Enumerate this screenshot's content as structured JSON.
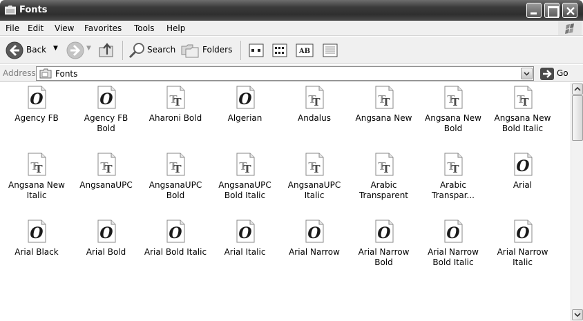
{
  "window": {
    "title": "Fonts"
  },
  "menu": [
    "File",
    "Edit",
    "View",
    "Favorites",
    "Tools",
    "Help"
  ],
  "toolbar": {
    "back_label": "Back",
    "search_label": "Search",
    "folders_label": "Folders"
  },
  "address": {
    "label": "Address",
    "value": "Fonts",
    "go_label": "Go"
  },
  "fonts": [
    {
      "name": "Agency FB",
      "type": "opentype"
    },
    {
      "name": "Agency FB\nBold",
      "type": "opentype"
    },
    {
      "name": "Aharoni Bold",
      "type": "truetype"
    },
    {
      "name": "Algerian",
      "type": "opentype"
    },
    {
      "name": "Andalus",
      "type": "truetype"
    },
    {
      "name": "Angsana New",
      "type": "truetype"
    },
    {
      "name": "Angsana New\nBold",
      "type": "truetype"
    },
    {
      "name": "Angsana New\nBold Italic",
      "type": "truetype"
    },
    {
      "name": "Angsana New\nItalic",
      "type": "truetype"
    },
    {
      "name": "AngsanaUPC",
      "type": "truetype"
    },
    {
      "name": "AngsanaUPC\nBold",
      "type": "truetype"
    },
    {
      "name": "AngsanaUPC\nBold Italic",
      "type": "truetype"
    },
    {
      "name": "AngsanaUPC\nItalic",
      "type": "truetype"
    },
    {
      "name": "Arabic\nTransparent",
      "type": "truetype"
    },
    {
      "name": "Arabic\nTranspar...",
      "type": "truetype"
    },
    {
      "name": "Arial",
      "type": "opentype"
    },
    {
      "name": "Arial Black",
      "type": "opentype"
    },
    {
      "name": "Arial Bold",
      "type": "opentype"
    },
    {
      "name": "Arial Bold Italic",
      "type": "opentype"
    },
    {
      "name": "Arial Italic",
      "type": "opentype"
    },
    {
      "name": "Arial Narrow",
      "type": "opentype"
    },
    {
      "name": "Arial Narrow\nBold",
      "type": "opentype"
    },
    {
      "name": "Arial Narrow\nBold Italic",
      "type": "opentype"
    },
    {
      "name": "Arial Narrow\nItalic",
      "type": "opentype"
    }
  ]
}
